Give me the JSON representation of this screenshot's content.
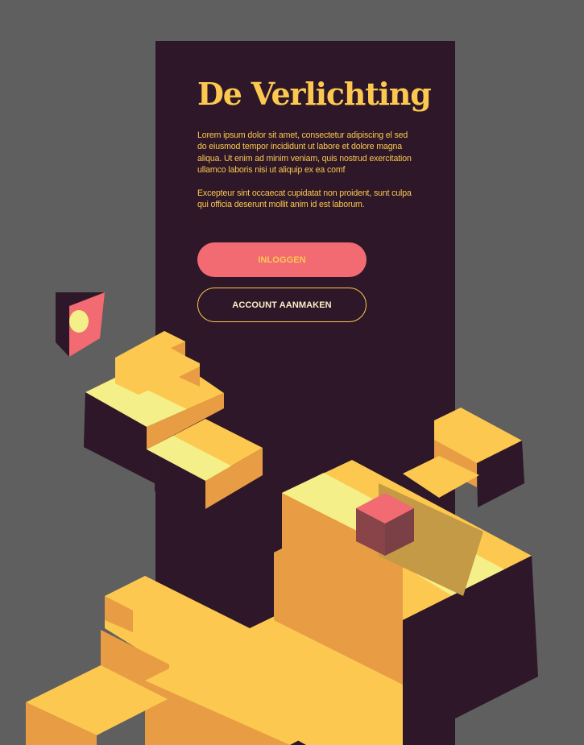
{
  "title": "De Verlichting",
  "intro": {
    "paragraph_1": "Lorem ipsum dolor sit amet, consectetur adipiscing el sed do eiusmod tempor incididunt ut labore et dolore magna aliqua. Ut enim ad minim veniam, quis nostrud exercitation ullamco laboris nisi ut aliquip ex ea comf",
    "paragraph_2": "Excepteur sint occaecat cupidatat non proident, sunt culpa qui officia deserunt mollit anim id est laborum."
  },
  "buttons": {
    "login_label": "INLOGGEN",
    "create_account_label": "ACCOUNT AANMAKEN"
  },
  "colors": {
    "background": "#5f5f5f",
    "panel": "#2d1728",
    "accent_yellow": "#fcc84f",
    "accent_coral": "#f26b72"
  }
}
